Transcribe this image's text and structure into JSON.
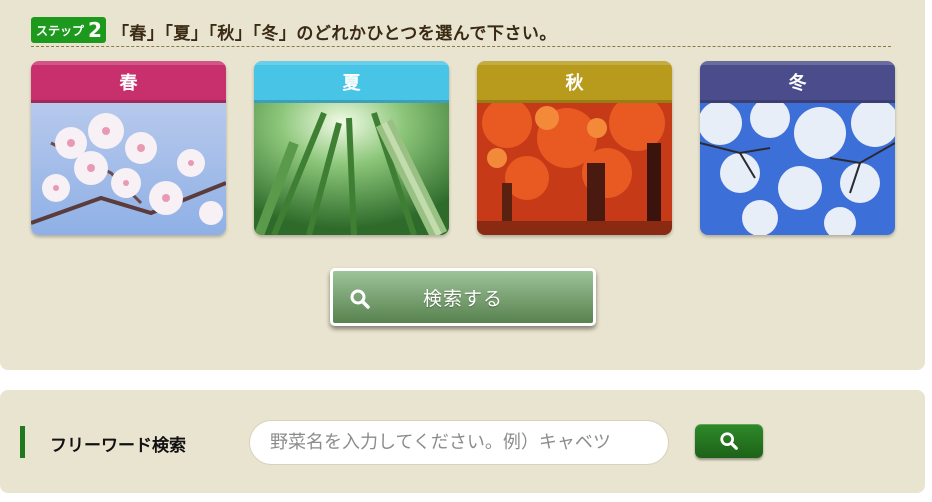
{
  "step": {
    "badge_word": "ステップ",
    "badge_number": "2",
    "title": "「春」「夏」「秋」「冬」のどれかひとつを選んで下さい。"
  },
  "seasons": [
    {
      "label": "春",
      "color": "#c7306d"
    },
    {
      "label": "夏",
      "color": "#48c4e6"
    },
    {
      "label": "秋",
      "color": "#b89a1c"
    },
    {
      "label": "冬",
      "color": "#4a4c8c"
    }
  ],
  "search_button": {
    "label": "検索する",
    "icon": "search-icon"
  },
  "free_word": {
    "label": "フリーワード検索",
    "placeholder": "野菜名を入力してください。例）キャベツ",
    "value": "",
    "button_icon": "search-icon"
  },
  "colors": {
    "panel": "#e9e4cf",
    "accent_green": "#1f7a1f"
  }
}
